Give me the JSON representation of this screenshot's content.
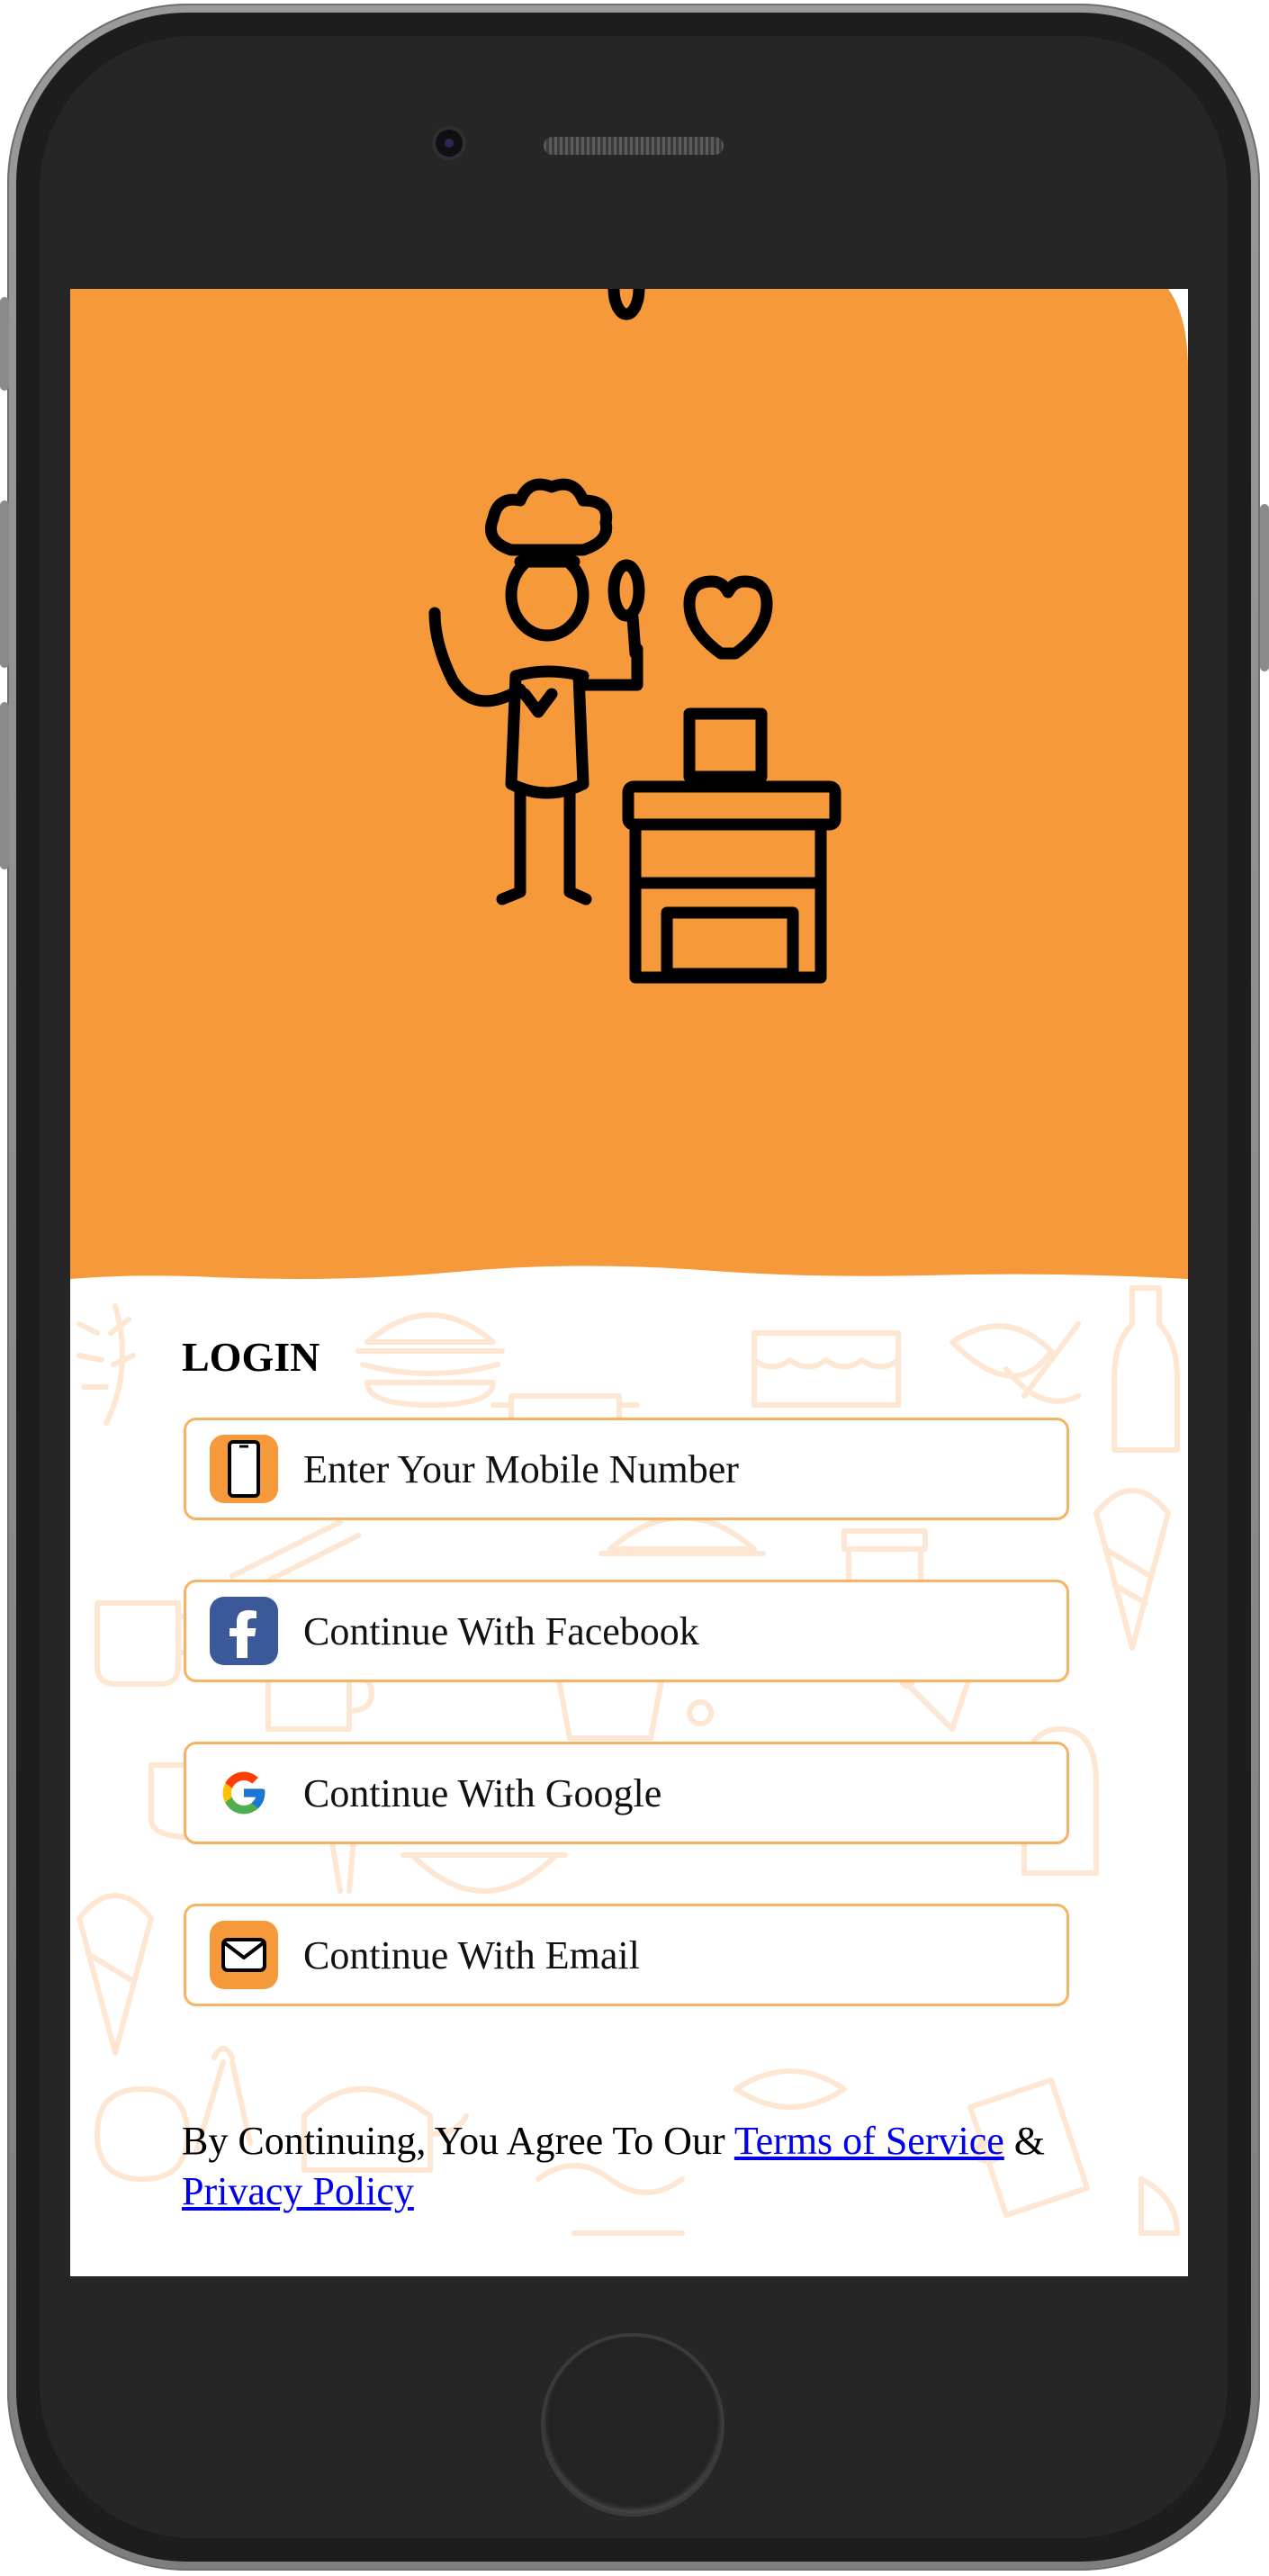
{
  "screen": {
    "title": "LOGIN",
    "hero_color": "#F5993A",
    "accent_border": "#F6B366"
  },
  "buttons": [
    {
      "label": "Enter Your Mobile Number",
      "icon": "mobile-phone-icon",
      "icon_bg": "#F5993A"
    },
    {
      "label": "Continue With Facebook",
      "icon": "facebook-icon",
      "icon_bg": "#3B5998"
    },
    {
      "label": "Continue With Google",
      "icon": "google-icon",
      "icon_bg": "#FFFFFF"
    },
    {
      "label": "Continue With Email",
      "icon": "email-icon",
      "icon_bg": "#F5993A"
    }
  ],
  "footer": {
    "prefix": "By Continuing, You Agree To Our",
    "terms_link": "Terms of Service",
    "connector": "&",
    "privacy_link": "Privacy Policy"
  }
}
